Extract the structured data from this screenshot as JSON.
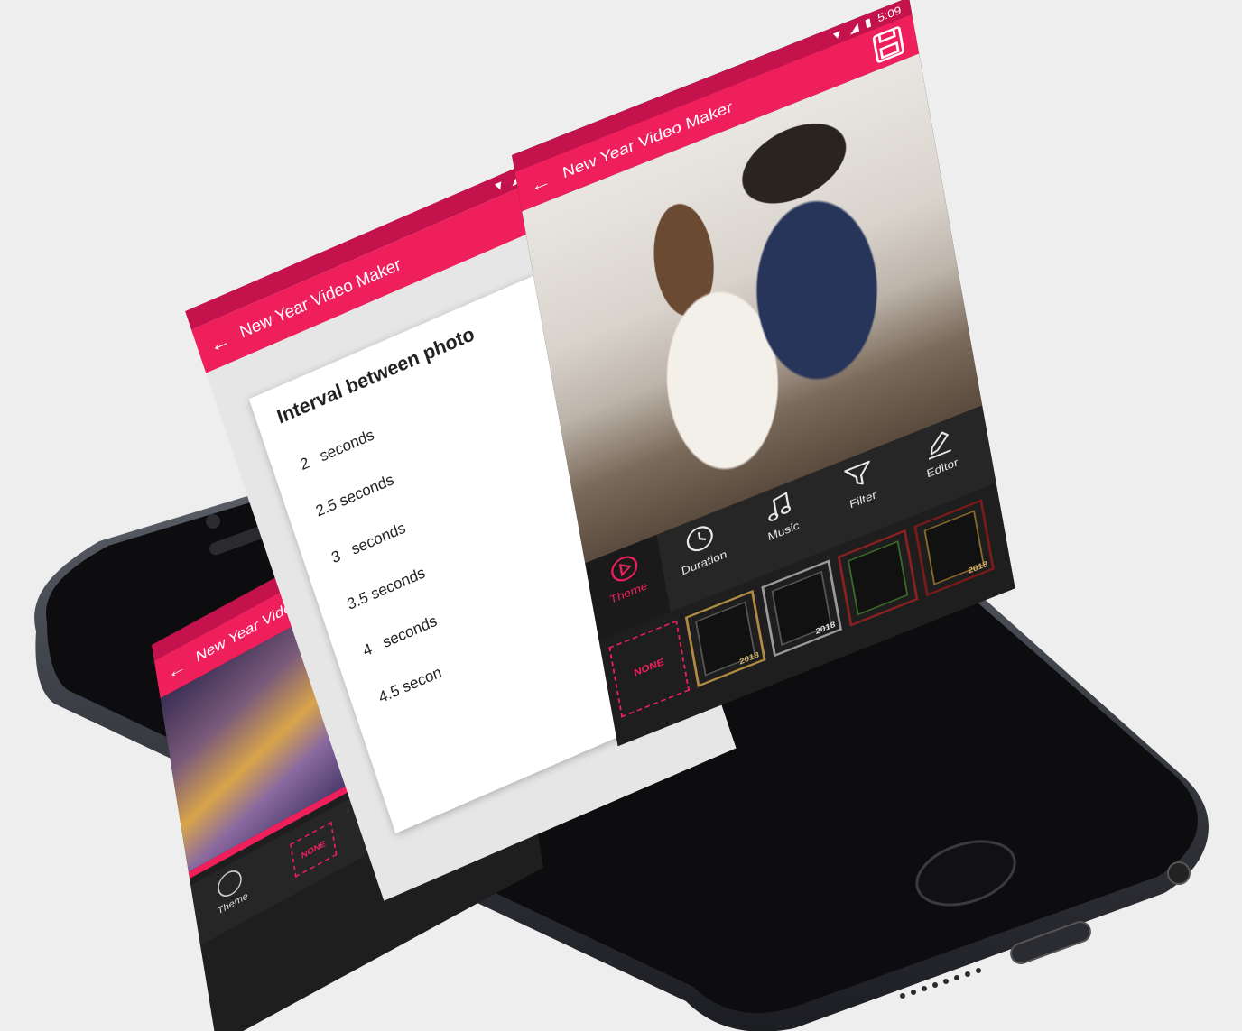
{
  "status_bar": {
    "time": "5:09"
  },
  "app": {
    "title": "New Year Video Maker",
    "title_truncated": "New Year Video Ma"
  },
  "interval_dialog": {
    "title": "Interval between photo",
    "options": [
      {
        "value": "2",
        "unit": "seconds"
      },
      {
        "value": "2.5 seconds",
        "unit": ""
      },
      {
        "value": "3",
        "unit": "seconds"
      },
      {
        "value": "3.5 seconds",
        "unit": ""
      },
      {
        "value": "4",
        "unit": "seconds"
      },
      {
        "value": "4.5 secon",
        "unit": ""
      }
    ]
  },
  "toolbar": {
    "theme": "Theme",
    "duration": "Duration",
    "music": "Music",
    "filter": "Filter",
    "editor": "Editor"
  },
  "frames": {
    "none_label": "NONE",
    "year_label": "2018"
  },
  "colors": {
    "accent": "#ef1f5c",
    "accent_dark": "#c4124c",
    "toolbar_bg": "#262626",
    "background": "#eeeeee"
  }
}
